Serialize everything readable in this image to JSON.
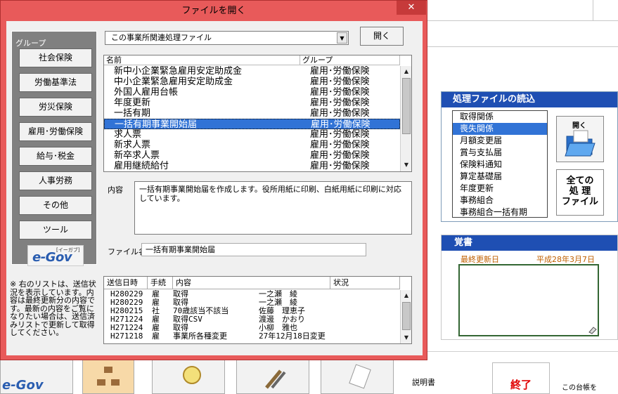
{
  "background": {
    "processing_panel": {
      "title": "処理ファイルの読込",
      "items": [
        "取得関係",
        "喪失関係",
        "月額変更届",
        "賞与支払届",
        "保険料通知",
        "算定基礎届",
        "年度更新",
        "事務組合",
        "事務組合一括有期"
      ],
      "selected_index": 1,
      "open_label": "開く",
      "all_files_label": [
        "全ての",
        "処 理",
        "ファイル"
      ]
    },
    "memo_panel": {
      "title": "覚書",
      "last_updated_label": "最終更新日",
      "last_updated_date": "平成28年3月7日"
    },
    "bottom_bar": {
      "manual_label": "説明書",
      "end_label": "終了",
      "daicho_label": "この台帳を"
    }
  },
  "dialog": {
    "title": "ファイルを開く",
    "close_label": "✕",
    "group_caption": "グループ",
    "groups": [
      "社会保険",
      "労働基準法",
      "労災保険",
      "雇用･労働保険",
      "給与･税金",
      "人事労務",
      "その他",
      "ツール"
    ],
    "egov_label": "e-Gov",
    "egov_sub": "[イーガブ]",
    "combo_value": "この事業所関連処理ファイル",
    "open_button": "開く",
    "list_headers": {
      "name": "名前",
      "group": "グループ"
    },
    "files": [
      {
        "name": "新中小企業緊急雇用安定助成金",
        "group": "雇用･労働保険"
      },
      {
        "name": "中小企業緊急雇用安定助成金",
        "group": "雇用･労働保険"
      },
      {
        "name": "外国人雇用台帳",
        "group": "雇用･労働保険"
      },
      {
        "name": "年度更新",
        "group": "雇用･労働保険"
      },
      {
        "name": "一括有期",
        "group": "雇用･労働保険"
      },
      {
        "name": "一括有期事業開始届",
        "group": "雇用･労働保険"
      },
      {
        "name": "求人票",
        "group": "雇用･労働保険"
      },
      {
        "name": "新求人票",
        "group": "雇用･労働保険"
      },
      {
        "name": "新卒求人票",
        "group": "雇用･労働保険"
      },
      {
        "name": "雇用継続給付",
        "group": "雇用･労働保険"
      }
    ],
    "selected_file_index": 5,
    "description_label": "内容",
    "description": "一括有期事業開始届を作成します。役所用紙に印刷、白紙用紙に印刷に対応しています。",
    "filename_label": "ファイル名",
    "filename": "一括有期事業開始届",
    "history_headers": {
      "date": "送信日時",
      "proc": "手続",
      "content": "内容",
      "status": "状況"
    },
    "history": [
      {
        "date": "H280229",
        "proc": "雇",
        "content": "取得",
        "person": "一之瀬　綾"
      },
      {
        "date": "H280229",
        "proc": "雇",
        "content": "取得",
        "person": "一之瀬　綾"
      },
      {
        "date": "H280215",
        "proc": "社",
        "content": "70歳該当不該当",
        "person": "佐藤　理恵子"
      },
      {
        "date": "H271224",
        "proc": "雇",
        "content": "取得CSV",
        "person": "渡邊　かおり"
      },
      {
        "date": "H271224",
        "proc": "雇",
        "content": "取得",
        "person": "小柳　雅也"
      },
      {
        "date": "H271218",
        "proc": "雇",
        "content": "事業所各種変更",
        "person": "27年12月18日変更"
      }
    ],
    "note": "※ 右のリストは、送信状況を表示しています。内容は最終更新分の内容です。最新の内容をご覧になりたい場合は、送信済みリストで更新して取得してください。"
  }
}
